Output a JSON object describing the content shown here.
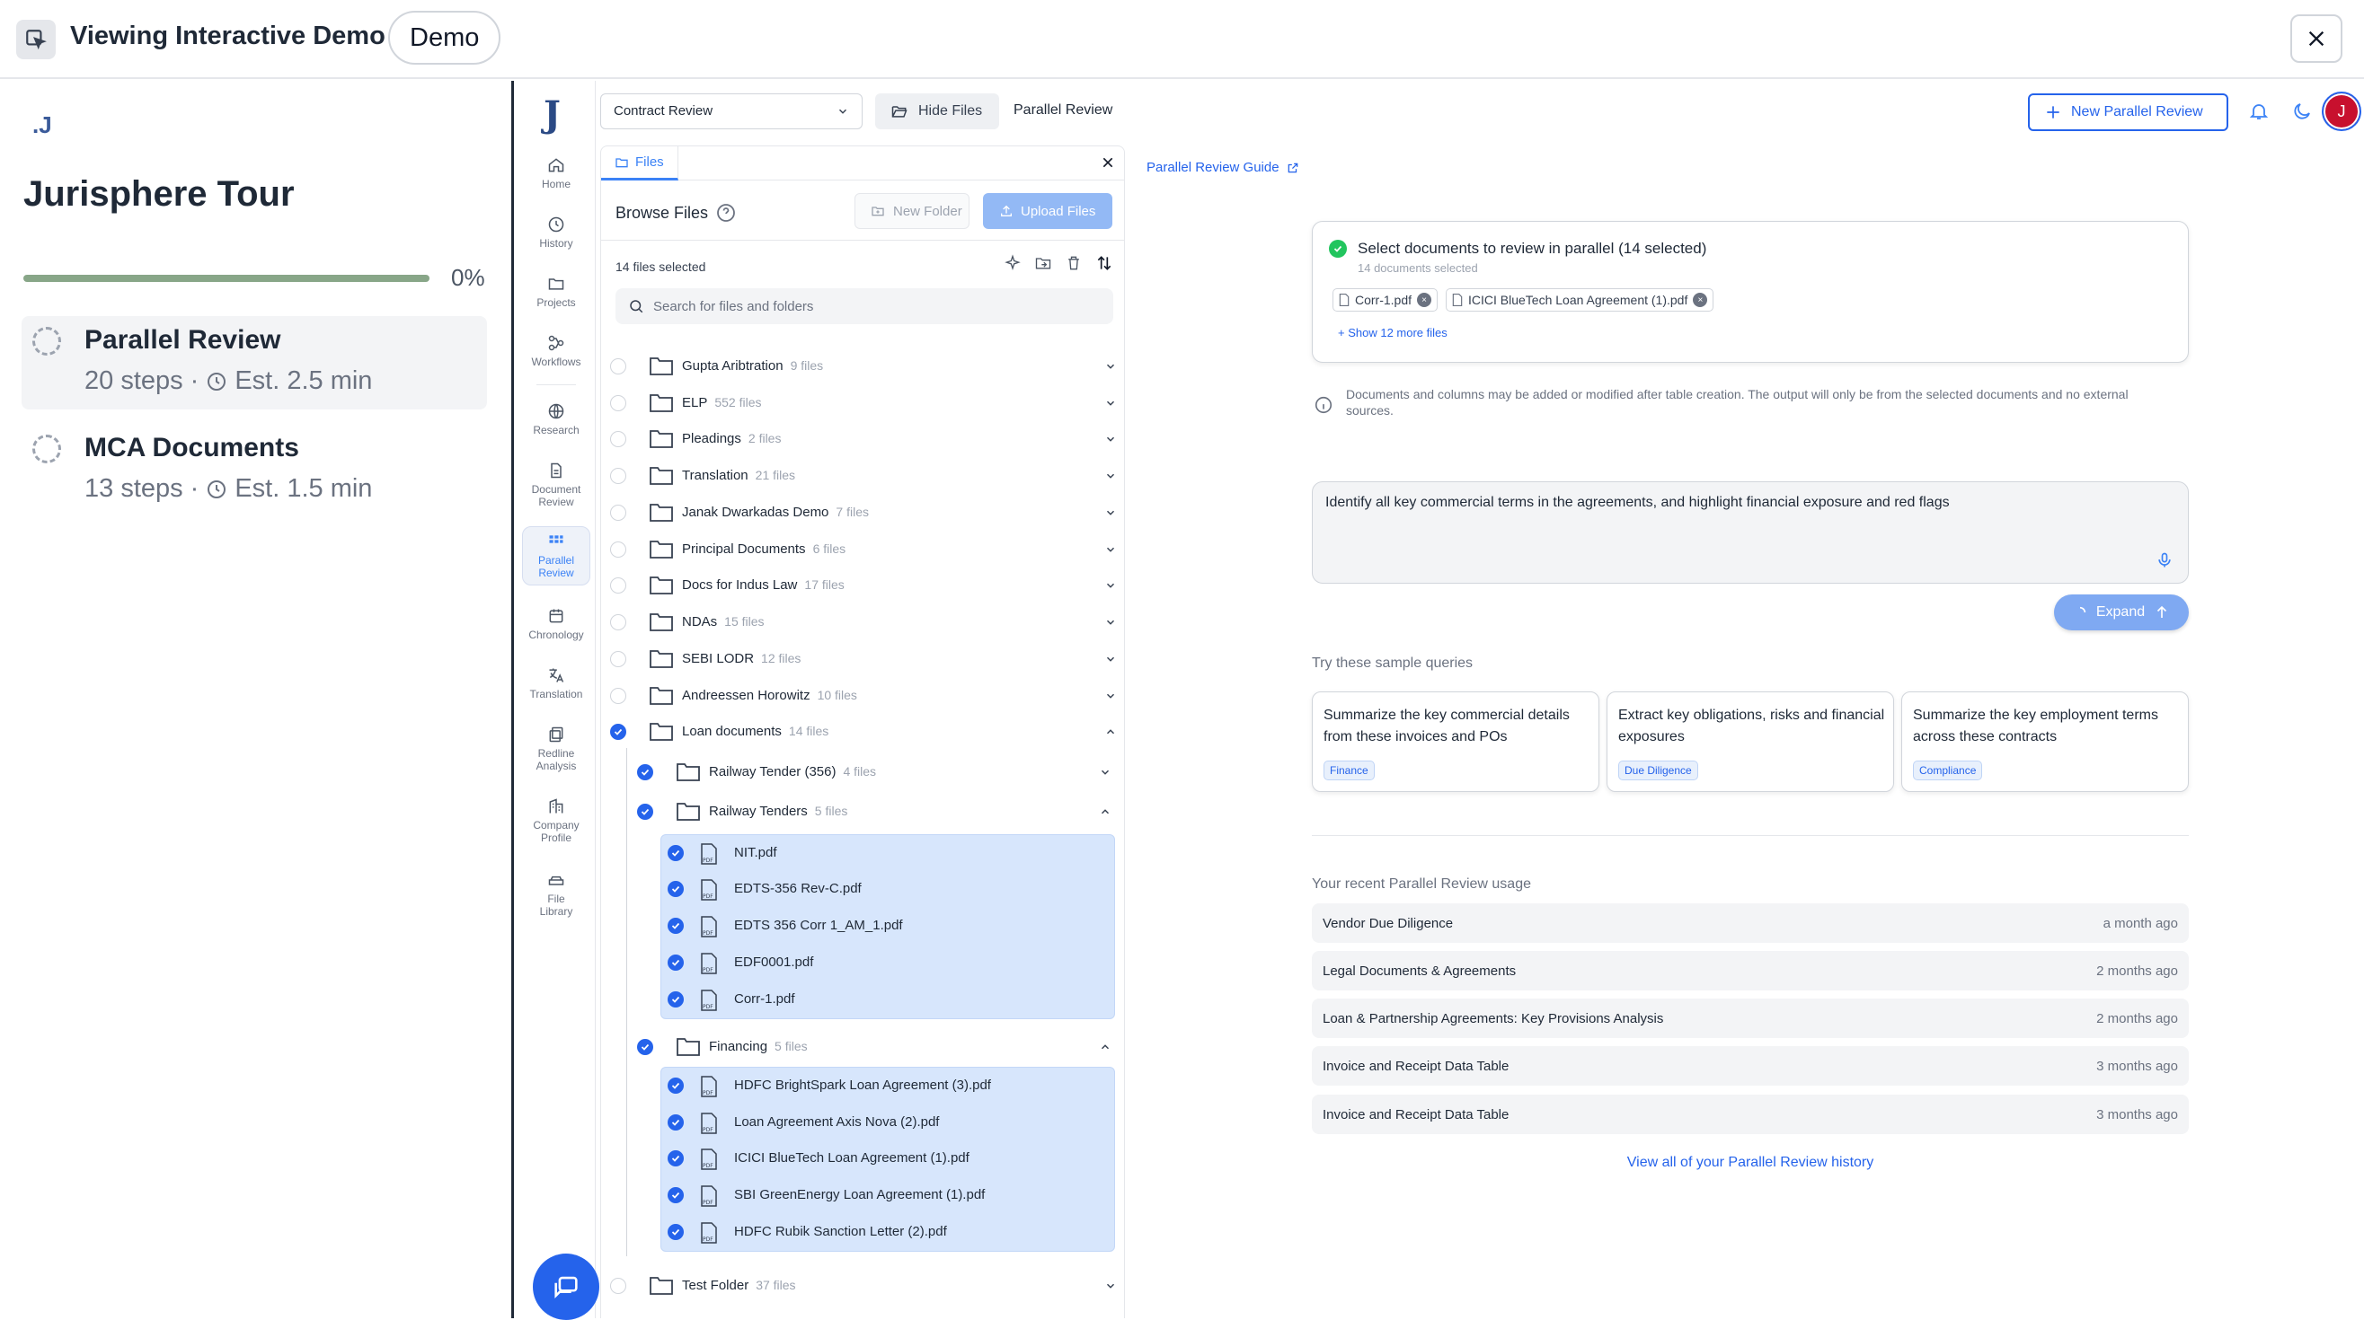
{
  "demo_bar": {
    "title": "Viewing Interactive Demo",
    "pill": "Demo"
  },
  "tour": {
    "logo": ".J",
    "title": "Jurisphere Tour",
    "progress_pct": 0,
    "progress_label": "0%",
    "items": [
      {
        "name": "Parallel Review",
        "steps": "20 steps",
        "sep": "·",
        "est": "Est. 2.5 min"
      },
      {
        "name": "MCA Documents",
        "steps": "13 steps",
        "sep": "·",
        "est": "Est. 1.5 min"
      }
    ]
  },
  "rail": {
    "logo": "J",
    "items": [
      {
        "label": "Home",
        "icon": "home-icon"
      },
      {
        "label": "History",
        "icon": "history-icon"
      },
      {
        "label": "Projects",
        "icon": "folder-icon"
      },
      {
        "label": "Workflows",
        "icon": "workflow-icon"
      },
      {
        "label": "Research",
        "icon": "globe-icon"
      },
      {
        "label": "Document Review",
        "icon": "document-icon"
      },
      {
        "label": "Parallel Review",
        "icon": "grid-icon"
      },
      {
        "label": "Chronology",
        "icon": "calendar-icon"
      },
      {
        "label": "Translation",
        "icon": "translate-icon"
      },
      {
        "label": "Redline Analysis",
        "icon": "redline-icon"
      },
      {
        "label": "Company Profile",
        "icon": "building-icon"
      },
      {
        "label": "File Library",
        "icon": "library-icon"
      }
    ]
  },
  "header": {
    "workspace_select": "Contract Review",
    "hide_files": "Hide Files",
    "breadcrumb": "Parallel Review",
    "new_button": "New Parallel Review",
    "avatar_initial": "J"
  },
  "files": {
    "tab": "Files",
    "browse_title": "Browse Files",
    "new_folder": "New Folder",
    "upload": "Upload Files",
    "selected_count": "14 files selected",
    "search_placeholder": "Search for files and folders",
    "folders_top": [
      {
        "name": "Gupta Aribtration",
        "count": "9 files"
      },
      {
        "name": "ELP",
        "count": "552 files"
      },
      {
        "name": "Pleadings",
        "count": "2 files"
      },
      {
        "name": "Translation",
        "count": "21 files"
      },
      {
        "name": "Janak Dwarkadas Demo",
        "count": "7 files"
      },
      {
        "name": "Principal Documents",
        "count": "6 files"
      },
      {
        "name": "Docs for Indus Law",
        "count": "17 files"
      },
      {
        "name": "NDAs",
        "count": "15 files"
      },
      {
        "name": "SEBI LODR",
        "count": "12 files"
      },
      {
        "name": "Andreessen Horowitz",
        "count": "10 files"
      }
    ],
    "loan_folder": {
      "name": "Loan documents",
      "count": "14 files"
    },
    "subfolders": [
      {
        "name": "Railway Tender (356)",
        "count": "4 files"
      },
      {
        "name": "Railway Tenders",
        "count": "5 files"
      },
      {
        "name": "Financing",
        "count": "5 files"
      }
    ],
    "railway_files": [
      "NIT.pdf",
      "EDTS-356 Rev-C.pdf",
      "EDTS 356 Corr 1_AM_1.pdf",
      "EDF0001.pdf",
      "Corr-1.pdf"
    ],
    "financing_files": [
      "HDFC BrightSpark Loan Agreement (3).pdf",
      "Loan Agreement Axis Nova (2).pdf",
      "ICICI BlueTech Loan Agreement (1).pdf",
      "SBI GreenEnergy Loan Agreement (1).pdf",
      "HDFC Rubik Sanction Letter (2).pdf"
    ],
    "test_folder": {
      "name": "Test Folder",
      "count": "37 files"
    }
  },
  "main": {
    "guide_link": "Parallel Review Guide",
    "select_title": "Select documents to review in parallel (14 selected)",
    "select_sub": "14 documents selected",
    "chips": [
      "Corr-1.pdf",
      "ICICI BlueTech Loan Agreement (1).pdf"
    ],
    "show_more": "+ Show 12 more files",
    "note": "Documents and columns may be added or modified after table creation. The output will only be from the selected documents and no external sources.",
    "query": "Identify all key commercial terms in the agreements, and highlight financial exposure and red flags",
    "expand": "Expand",
    "try_label": "Try these sample queries",
    "samples": [
      {
        "text": "Summarize the key commercial details from these invoices and POs",
        "tag": "Finance"
      },
      {
        "text": "Extract key obligations, risks and financial exposures",
        "tag": "Due Diligence"
      },
      {
        "text": "Summarize the key employment terms across these contracts",
        "tag": "Compliance"
      }
    ],
    "recent_label": "Your recent Parallel Review usage",
    "recent": [
      {
        "name": "Vendor Due Diligence",
        "time": "a month ago"
      },
      {
        "name": "Legal Documents & Agreements",
        "time": "2 months ago"
      },
      {
        "name": "Loan & Partnership Agreements: Key Provisions Analysis",
        "time": "2 months ago"
      },
      {
        "name": "Invoice and Receipt Data Table",
        "time": "3 months ago"
      },
      {
        "name": "Invoice and Receipt Data Table",
        "time": "3 months ago"
      }
    ],
    "view_all": "View all of your Parallel Review history"
  },
  "colors": {
    "accent": "#2563eb",
    "selected_bg": "#d7e6fc",
    "progress": "#88a688",
    "avatar": "#c8102e"
  }
}
